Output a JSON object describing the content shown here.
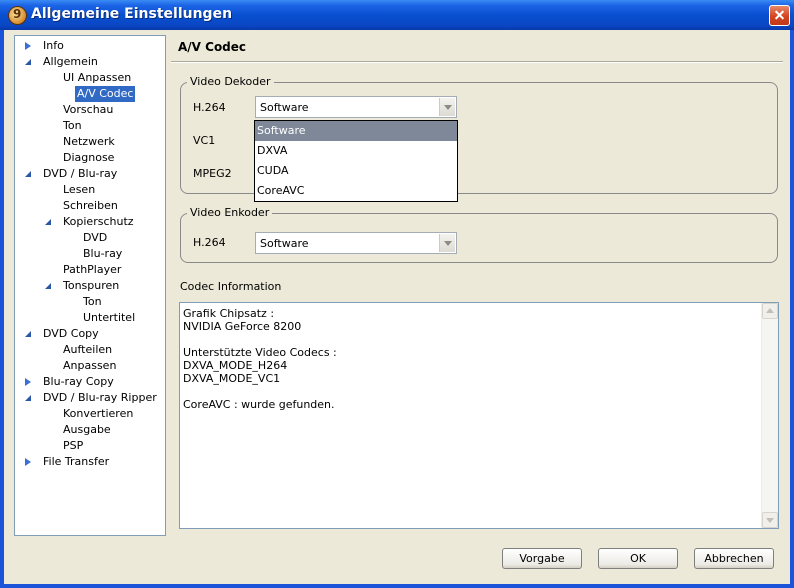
{
  "window": {
    "title": "Allgemeine Einstellungen"
  },
  "tree": {
    "items": [
      {
        "label": "Info",
        "toggle": "collapsed"
      },
      {
        "label": "Allgemein",
        "toggle": "expanded"
      },
      {
        "label": "UI Anpassen",
        "toggle": ""
      },
      {
        "label": "A/V Codec",
        "toggle": "",
        "selected": true
      },
      {
        "label": "Vorschau",
        "toggle": ""
      },
      {
        "label": "Ton",
        "toggle": ""
      },
      {
        "label": "Netzwerk",
        "toggle": ""
      },
      {
        "label": "Diagnose",
        "toggle": ""
      },
      {
        "label": "DVD / Blu-ray",
        "toggle": "expanded"
      },
      {
        "label": "Lesen",
        "toggle": ""
      },
      {
        "label": "Schreiben",
        "toggle": ""
      },
      {
        "label": "Kopierschutz",
        "toggle": "expanded"
      },
      {
        "label": "DVD",
        "toggle": ""
      },
      {
        "label": "Blu-ray",
        "toggle": ""
      },
      {
        "label": "PathPlayer",
        "toggle": ""
      },
      {
        "label": "Tonspuren",
        "toggle": "expanded"
      },
      {
        "label": "Ton",
        "toggle": ""
      },
      {
        "label": "Untertitel",
        "toggle": ""
      },
      {
        "label": "DVD Copy",
        "toggle": "expanded"
      },
      {
        "label": "Aufteilen",
        "toggle": ""
      },
      {
        "label": "Anpassen",
        "toggle": ""
      },
      {
        "label": "Blu-ray Copy",
        "toggle": "collapsed"
      },
      {
        "label": "DVD / Blu-ray Ripper",
        "toggle": "expanded"
      },
      {
        "label": "Konvertieren",
        "toggle": ""
      },
      {
        "label": "Ausgabe",
        "toggle": ""
      },
      {
        "label": "PSP",
        "toggle": ""
      },
      {
        "label": "File Transfer",
        "toggle": "collapsed"
      }
    ]
  },
  "panel": {
    "title": "A/V Codec",
    "decoder": {
      "group_label": "Video Dekoder",
      "h264_label": "H.264",
      "h264_value": "Software",
      "vc1_label": "VC1",
      "mpeg2_label": "MPEG2"
    },
    "dropdown": {
      "options": [
        "Software",
        "DXVA",
        "CUDA",
        "CoreAVC"
      ],
      "highlighted_index": 0
    },
    "encoder": {
      "group_label": "Video Enkoder",
      "h264_label": "H.264",
      "h264_value": "Software"
    },
    "codec_info": {
      "label": "Codec Information",
      "lines": [
        "Grafik Chipsatz :",
        "NVIDIA GeForce 8200",
        "",
        "Unterstützte Video Codecs :",
        "DXVA_MODE_H264",
        "DXVA_MODE_VC1",
        "",
        "CoreAVC : wurde gefunden."
      ]
    }
  },
  "buttons": {
    "default": "Vorgabe",
    "ok": "OK",
    "cancel": "Abbrechen"
  }
}
